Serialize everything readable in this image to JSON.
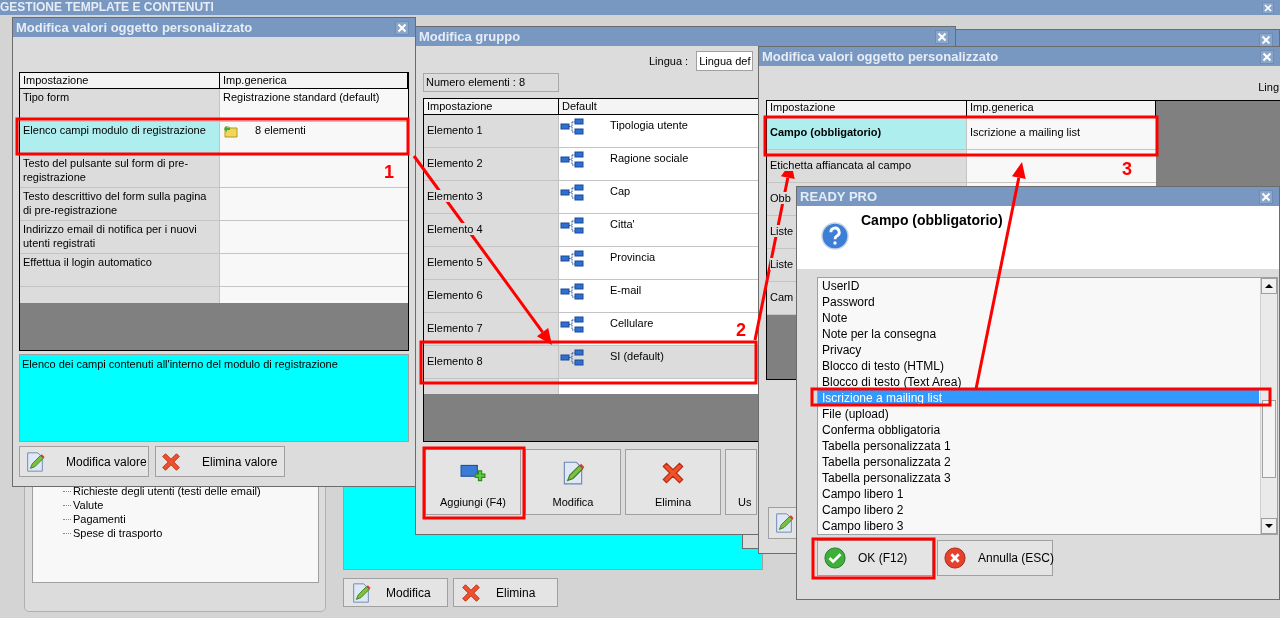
{
  "main_window": {
    "title": "GESTIONE TEMPLATE E CONTENUTI",
    "tree_items": [
      "Richieste degli utenti (testi delle email)",
      "Valute",
      "Pagamenti",
      "Spese di trasporto"
    ],
    "buttons": [
      {
        "label": "Modifica",
        "kind": "edit"
      },
      {
        "label": "Elimina",
        "kind": "delete"
      }
    ]
  },
  "settings_window": {
    "title": "Modifica valori oggetto personalizzato",
    "columns": [
      "Impostazione",
      "Imp.generica"
    ],
    "rows": [
      {
        "setting": "Tipo form",
        "value": "Registrazione standard (default)",
        "selected": false
      },
      {
        "setting": "Elenco campi modulo di registrazione",
        "value": "8 elementi",
        "kind": "folder",
        "selected": true
      },
      {
        "setting": "Testo del pulsante sul form di pre-registrazione",
        "selected": false
      },
      {
        "setting": "Testo descrittivo del form sulla pagina di pre-registrazione",
        "selected": false
      },
      {
        "setting": "Indirizzo email di notifica per i nuovi utenti registrati",
        "selected": false
      },
      {
        "setting": "Effettua il login automatico",
        "selected": false
      }
    ],
    "description": "Elenco dei campi contenuti all'interno del modulo di registrazione",
    "buttons": [
      {
        "label": "Modifica valore",
        "kind": "edit"
      },
      {
        "label": "Elimina valore",
        "kind": "delete"
      }
    ]
  },
  "group_window": {
    "title": "Modifica gruppo",
    "language_label": "Lingua :",
    "language_value": "Lingua def",
    "count": "Numero elementi : 8",
    "columns": [
      "Impostazione",
      "Default"
    ],
    "rows": [
      {
        "label": "Elemento 1",
        "value": "Tipologia utente",
        "selected": false
      },
      {
        "label": "Elemento 2",
        "value": "Ragione sociale",
        "selected": false
      },
      {
        "label": "Elemento 3",
        "value": "Cap",
        "selected": false
      },
      {
        "label": "Elemento 4",
        "value": "Citta'",
        "selected": false
      },
      {
        "label": "Elemento 5",
        "value": "Provincia",
        "selected": false
      },
      {
        "label": "Elemento 6",
        "value": "E-mail",
        "selected": false
      },
      {
        "label": "Elemento 7",
        "value": "Cellulare",
        "selected": false
      },
      {
        "label": "Elemento 8",
        "value": "SI (default)",
        "selected": true
      }
    ],
    "buttons": [
      {
        "label": "Aggiungi (F4)",
        "kind": "add"
      },
      {
        "label": "Modifica",
        "kind": "edit"
      },
      {
        "label": "Elimina",
        "kind": "delete"
      },
      {
        "label": "Us",
        "kind": "plain"
      }
    ]
  },
  "field_window": {
    "title": "Modifica valori oggetto personalizzato",
    "language_label": "Ling",
    "columns": [
      "Impostazione",
      "Imp.generica"
    ],
    "rows": [
      {
        "setting": "Campo (obbligatorio)",
        "value": "Iscrizione a mailing list",
        "selected": true
      },
      {
        "setting": "Etichetta affiancata al campo",
        "selected": false
      },
      {
        "setting": "Obb",
        "selected": false
      },
      {
        "setting": "Liste",
        "selected": false
      },
      {
        "setting": "Liste",
        "selected": false
      },
      {
        "setting": "Cam",
        "selected": false
      }
    ],
    "buttons": [
      {
        "kind": "edit"
      }
    ]
  },
  "dialog": {
    "title": "READY PRO",
    "heading": "Campo (obbligatorio)",
    "options": [
      {
        "label": "UserID",
        "selected": false
      },
      {
        "label": "Password",
        "selected": false
      },
      {
        "label": "Note",
        "selected": false
      },
      {
        "label": "Note per la consegna",
        "selected": false
      },
      {
        "label": "Privacy",
        "selected": false
      },
      {
        "label": "Blocco di testo (HTML)",
        "selected": false
      },
      {
        "label": "Blocco di testo (Text Area)",
        "selected": false
      },
      {
        "label": "Iscrizione a mailing list",
        "selected": true
      },
      {
        "label": "File (upload)",
        "selected": false
      },
      {
        "label": "Conferma obbligatoria",
        "selected": false
      },
      {
        "label": "Tabella personalizzata 1",
        "selected": false
      },
      {
        "label": "Tabella personalizzata 2",
        "selected": false
      },
      {
        "label": "Tabella personalizzata 3",
        "selected": false
      },
      {
        "label": "Campo libero 1",
        "selected": false
      },
      {
        "label": "Campo libero 2",
        "selected": false
      },
      {
        "label": "Campo libero 3",
        "selected": false
      }
    ],
    "buttons": [
      {
        "label": "OK (F12)",
        "kind": "ok"
      },
      {
        "label": "Annulla (ESC)",
        "kind": "cancel"
      }
    ]
  },
  "annotations": {
    "numbers": [
      "1",
      "2",
      "3"
    ]
  }
}
